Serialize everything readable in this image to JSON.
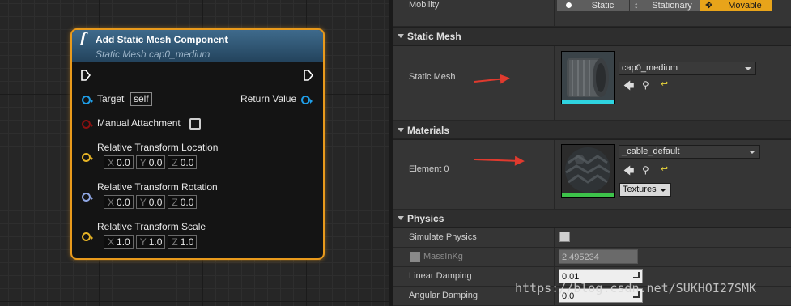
{
  "node": {
    "title": "Add Static Mesh Component",
    "subtitle": "Static Mesh cap0_medium",
    "fn_icon": "f",
    "pins": {
      "target_label": "Target",
      "target_value": "self",
      "return_label": "Return Value",
      "manual_attachment_label": "Manual Attachment",
      "location_label": "Relative Transform Location",
      "rotation_label": "Relative Transform Rotation",
      "scale_label": "Relative Transform Scale"
    },
    "location": {
      "x": "0.0",
      "y": "0.0",
      "z": "0.0"
    },
    "rotation": {
      "x": "0.0",
      "y": "0.0",
      "z": "0.0"
    },
    "scale": {
      "x": "1.0",
      "y": "1.0",
      "z": "1.0"
    },
    "axis": {
      "x": "X",
      "y": "Y",
      "z": "Z"
    },
    "colors": {
      "border": "#e99a1c",
      "object_pin": "#1f9ee8",
      "struct_pin": "#e6b325",
      "bool_pin": "#8a1010",
      "rotator_pin": "#8fa6e3"
    }
  },
  "details": {
    "mobility": {
      "label": "Mobility",
      "options": [
        "Static",
        "Stationary",
        "Movable"
      ],
      "selected": "Movable"
    },
    "static_mesh": {
      "category": "Static Mesh",
      "label": "Static Mesh",
      "value": "cap0_medium"
    },
    "materials": {
      "category": "Materials",
      "label": "Element 0",
      "value": "_cable_default",
      "textures_button": "Textures"
    },
    "physics": {
      "category": "Physics",
      "simulate_label": "Simulate Physics",
      "mass_label": "MassInKg",
      "mass_value": "2.495234",
      "linear_label": "Linear Damping",
      "linear_value": "0.01",
      "angular_label": "Angular Damping",
      "angular_value": "0.0"
    }
  },
  "watermark": "https://blog.csdn.net/SUKHOI27SMK"
}
